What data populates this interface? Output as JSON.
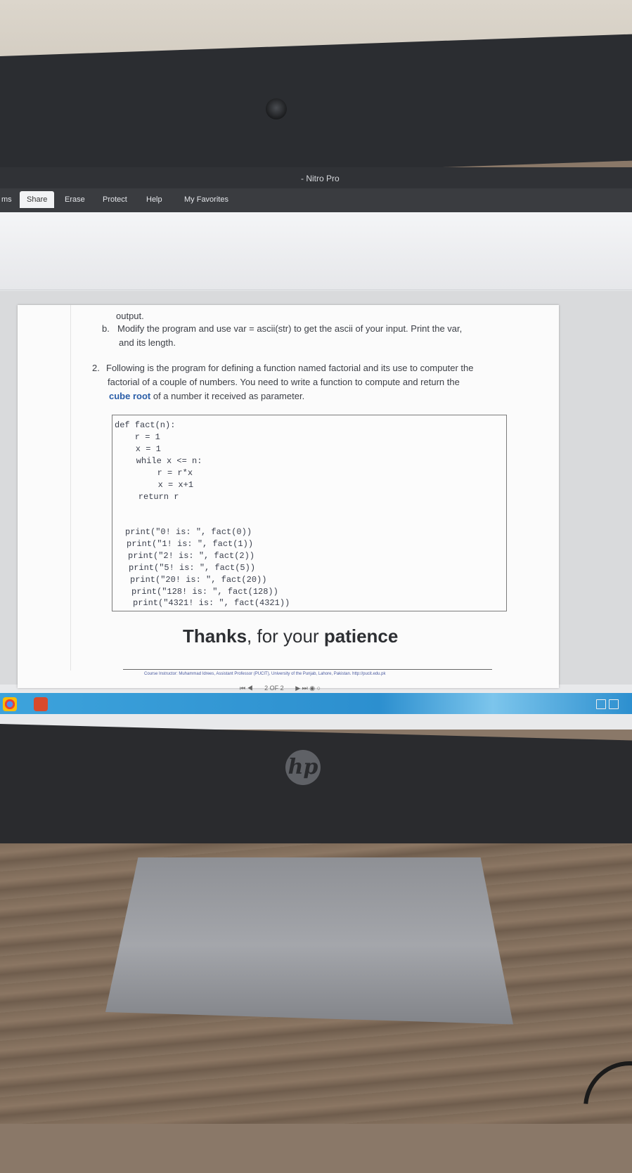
{
  "window": {
    "title": "- Nitro Pro"
  },
  "ribbon": {
    "tabs": [
      "ms",
      "Share",
      "Erase",
      "Protect",
      "Help",
      "My Favorites"
    ],
    "active_tab": "Share"
  },
  "document": {
    "line_output": "output.",
    "item_b_prefix": "b.",
    "item_b_line1": "Modify the program and use var = ascii(str) to get the ascii of your input. Print the var,",
    "item_b_line2": "and its length.",
    "item_2_prefix": "2.",
    "item_2_line1": "Following is the program for defining a function named factorial and its use to computer the",
    "item_2_line2": "factorial of a couple of numbers. You need to write a function to compute and return the",
    "item_2_line3_bold": "cube root",
    "item_2_line3_rest": " of a number it received as parameter.",
    "code_lines": [
      "def fact(n):",
      "    r = 1",
      "    x = 1",
      "    while x <= n:",
      "        r = r*x",
      "        x = x+1",
      "    return r",
      "",
      "print(\"0! is: \", fact(0))",
      "print(\"1! is: \", fact(1))",
      "print(\"2! is: \", fact(2))",
      "print(\"5! is: \", fact(5))",
      "print(\"20! is: \", fact(20))",
      "print(\"128! is: \", fact(128))",
      "print(\"4321! is: \", fact(4321))"
    ],
    "thanks_1": "Thanks",
    "thanks_2": ", for your ",
    "thanks_3": "patience",
    "footer": "Course Instructor: Muhammad Idrees, Assistant Professor (PUCIT), University of the Punjab, Lahore, Pakistan. http://pucit.edu.pk"
  },
  "pager": {
    "label": "2 OF 2"
  },
  "brand": {
    "logo": "hp"
  },
  "colors": {
    "taskbar": "#2c8fcf",
    "bezel": "#2a2b2e",
    "link_blue": "#2b5ea8"
  }
}
